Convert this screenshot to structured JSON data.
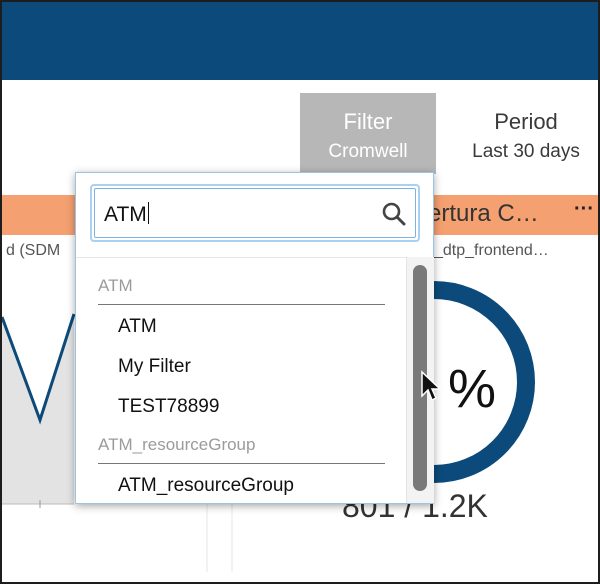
{
  "header": {
    "color": "#0b4a7a"
  },
  "filter": {
    "label": "Filter",
    "value": "Cromwell"
  },
  "period": {
    "label": "Period",
    "value": "Last 30 days"
  },
  "widget": {
    "title": "ertura C…",
    "more": "···",
    "left_subtitle": "d (SDM",
    "right_subtitle": "_dtp_frontend…",
    "gauge_value": "%",
    "gauge_sub": "801 / 1.2K"
  },
  "dropdown": {
    "search_value": "ATM",
    "groups": [
      {
        "header": "ATM",
        "items": [
          "ATM",
          "My Filter",
          "TEST78899"
        ]
      },
      {
        "header": "ATM_resourceGroup",
        "items": [
          "ATM_resourceGroup"
        ]
      }
    ]
  },
  "colors": {
    "accent": "#0b4a7a",
    "orange": "#f4a070",
    "filter_bg": "#b7b7b7",
    "focus": "#a9d1f1"
  }
}
